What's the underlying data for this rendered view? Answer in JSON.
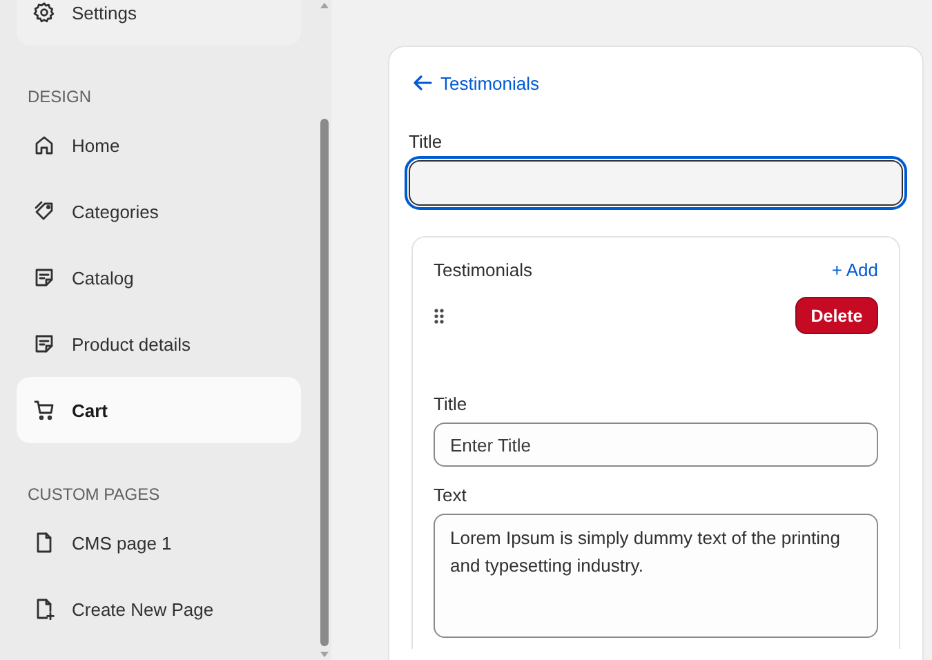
{
  "sidebar": {
    "top_items": [
      {
        "label": "Settings",
        "kind": "gear",
        "selected": false
      }
    ],
    "sections": [
      {
        "heading": "DESIGN",
        "items": [
          {
            "label": "Home",
            "kind": "home",
            "selected": false
          },
          {
            "label": "Categories",
            "kind": "tag",
            "selected": false
          },
          {
            "label": "Catalog",
            "kind": "note",
            "selected": false
          },
          {
            "label": "Product details",
            "kind": "note",
            "selected": false
          },
          {
            "label": "Cart",
            "kind": "cart",
            "selected": true
          }
        ]
      },
      {
        "heading": "CUSTOM PAGES",
        "items": [
          {
            "label": "CMS page 1",
            "kind": "page",
            "selected": false
          },
          {
            "label": "Create New Page",
            "kind": "page-plus",
            "selected": false
          }
        ]
      }
    ]
  },
  "panel": {
    "back_link": "Testimonials",
    "title_field": {
      "label": "Title",
      "focused": true
    },
    "group": {
      "heading": "Testimonials",
      "add_button": "+ Add",
      "items": [
        {
          "delete_button": "Delete",
          "fields": [
            {
              "kind": "input",
              "label": "Title",
              "placeholder": "Enter Title"
            },
            {
              "kind": "textarea",
              "label": "Text",
              "value": "Lorem Ipsum is simply dummy text of the printing and typesetting industry."
            }
          ]
        }
      ]
    }
  }
}
